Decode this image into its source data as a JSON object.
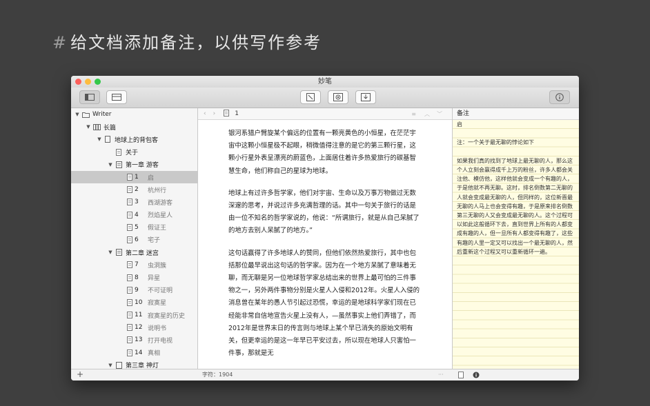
{
  "slide": {
    "hash": "#",
    "title": "给文档添加备注，以供写作参考"
  },
  "window": {
    "title": "妙笔"
  },
  "sidebar": {
    "root": "Writer",
    "section": "长篇",
    "book": "地球上的背包客",
    "about": "关于",
    "chapter1": "第一章 游客",
    "items1": [
      {
        "num": "1",
        "label": "启"
      },
      {
        "num": "2",
        "label": "杭州行"
      },
      {
        "num": "3",
        "label": "西湖游客"
      },
      {
        "num": "4",
        "label": "烈焰星人"
      },
      {
        "num": "5",
        "label": "假证王"
      },
      {
        "num": "6",
        "label": "宅子"
      }
    ],
    "chapter2": "第二章 迷宫",
    "items2": [
      {
        "num": "7",
        "label": "虫洞簇"
      },
      {
        "num": "8",
        "label": "异星"
      },
      {
        "num": "9",
        "label": "不可证明"
      },
      {
        "num": "10",
        "label": "寂寞星"
      },
      {
        "num": "11",
        "label": "寂寞星的历史"
      },
      {
        "num": "12",
        "label": "说明书"
      },
      {
        "num": "13",
        "label": "打开电视"
      },
      {
        "num": "14",
        "label": "真相"
      }
    ],
    "chapter3": "第三章 神灯",
    "add_label": "+"
  },
  "editor": {
    "doc_num": "1",
    "paragraphs": [
      "银河系猎户臂旋某个偏远的位置有一颗亮黄色的小恒星，在茫茫宇宙中这颗小恒星极不起眼，稍微值得注意的是它的第三颗行星，这颗小行星外表呈漂亮的蔚蓝色，上面居住着许多热爱旅行的碳基智慧生命，他们称自己的星球为地球。",
      "地球上有过许多哲学家，他们对宇宙、生命以及万事万物做过无数深邃的思考，并说过许多充满哲理的话。其中一句关于旅行的话是由一位不知名的哲学家说的，他说：“所谓旅行，就是从自己呆腻了的地方去别人呆腻了的地方。”",
      "这句话赢得了许多地球人的赞同，但他们依然热爱旅行，其中也包括那位最早说出这句话的哲学家。因为在一个地方呆腻了意味着无聊，而无聊是另一位地球哲学家总结出来的世界上最可怕的三件事物之一，另外两件事物分别是火星人入侵和2012年。火星人入侵的消息曾在某年的愚人节引起过恐慌，幸运的是地球科学家们现在已经能非常自信地宣告火星上没有人，—虽然事实上他们弄错了，而2012年是世界末日的传言则与地球上某个早已消失的原始文明有关，但更幸运的是这一年早已平安过去，所以现在地球人只害怕一件事，那就是无"
    ],
    "status": "字符：1904",
    "more": "···"
  },
  "notes": {
    "header": "备注",
    "title": "启",
    "note_line": "注：一个关于最无聊的悖论如下",
    "body": "如果我们真的找到了地球上最无聊的人，那么这个人立刻会赢得成千上万的粉丝，许多人都会关注他、模仿他，这样他就会变成一个有趣的人，于是他就不再无聊。这时，排名倒数第二无聊的人就会变成最无聊的人，但同样的，这位新晋最无聊的人马上也会变得有趣，于是原来排名倒数第三无聊的人又会变成最无聊的人。这个过程可以如此这般循环下去，直到世界上所有的人都变成有趣的人，但一旦所有人都变得有趣了，这些有趣的人里一定又可以找出一个最无聊的人，然后重新这个过程又可以重新循环一遍。"
  }
}
